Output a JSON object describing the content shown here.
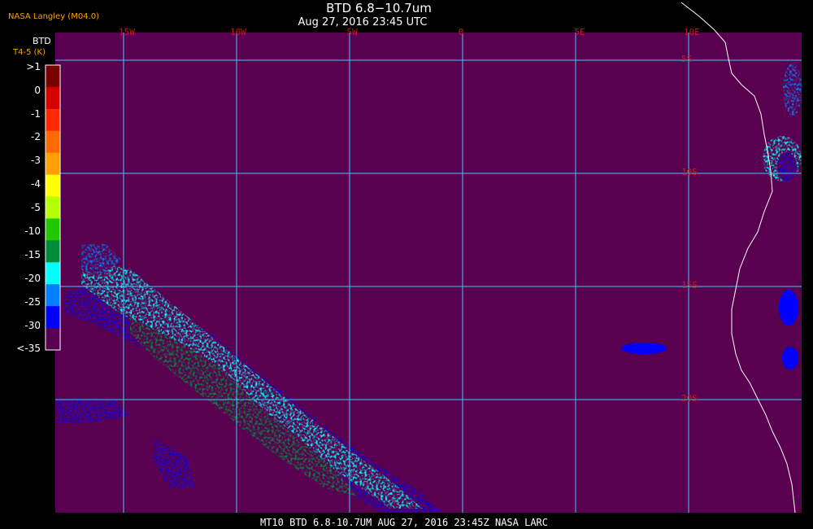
{
  "header": {
    "producer": "NASA Langley (M04.0)",
    "title": "BTD 6.8−10.7um",
    "subtitle": "Aug 27, 2016 23:45 UTC"
  },
  "colorbar": {
    "title": "BTD",
    "units": "T4-5 (K)",
    "labels": [
      ">1",
      "0",
      "-1",
      "-2",
      "-3",
      "-4",
      "-5",
      "-10",
      "-15",
      "-20",
      "-25",
      "-30",
      "<-35"
    ],
    "colors": [
      "#7a0000",
      "#d40000",
      "#ff2a00",
      "#ff6a00",
      "#ffa000",
      "#ffff00",
      "#b4ff00",
      "#20c800",
      "#008a3a",
      "#00ffff",
      "#0080ff",
      "#0000ff",
      "#5a0050"
    ]
  },
  "axes": {
    "longitude_labels": [
      "15W",
      "10W",
      "5W",
      "0",
      "5E",
      "10E"
    ],
    "latitude_labels": [
      "5S",
      "10S",
      "15S",
      "20S"
    ]
  },
  "map": {
    "background_color": "#5a0050",
    "grid_color": "#40c8ff",
    "coast_color": "#ffffff"
  },
  "footer": {
    "text": "MT10  BTD 6.8-10.7UM   AUG 27, 2016 23:45Z   NASA LARC"
  }
}
